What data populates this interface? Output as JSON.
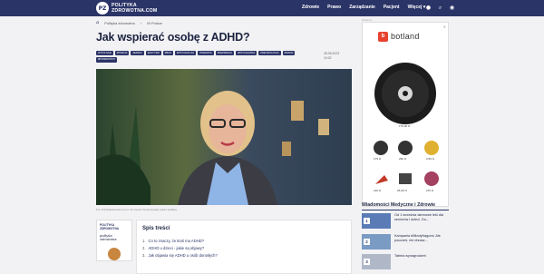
{
  "header": {
    "logo_badge": "PZ",
    "logo_line1": "POLITYKA",
    "logo_line2": "ZDROWOTNA.COM",
    "nav": [
      "Zdrowie",
      "Prawo",
      "Zarządzanie",
      "Pacjent",
      "Więcej"
    ],
    "nav_more_icon": "chevron-down-icon",
    "icons": [
      "user-icon",
      "search-icon",
      "account-icon"
    ],
    "colors": {
      "navy": "#2b3467"
    }
  },
  "breadcrumb": {
    "items": [
      "Polityka zdrowotna",
      "W Polsce"
    ]
  },
  "article": {
    "title": "Jak wspierać osobę z ADHD?",
    "tags": [
      "W POLSCE",
      "#PSMOA",
      "#EDIDU",
      "#AUTYZM",
      "#BAS",
      "#PSYCHOLOG",
      "#TERAPIA",
      "#DEPRESJA",
      "#PSYCHIATRA",
      "#NEUROLOGIA",
      "#MAMA",
      "#PODROSTNY"
    ],
    "date_line1": "28.06.2023",
    "date_line2": "10:02",
    "caption": "Fot. PoliTykaZdrowotna.com / Dr Joanna Tomaszewska, lekarz pediatra",
    "author_logo_line1": "POLITYKA",
    "author_logo_line2": "ZDROWOTNA",
    "author_name_line1": "polityka",
    "author_name_line2": "zdrowotna"
  },
  "toc": {
    "title": "Spis treści",
    "items": [
      {
        "num": "1.",
        "label": "Co to znaczy, że ktoś ma ADHD?"
      },
      {
        "num": "2.",
        "label": "ADHD u dzieci - jakie są objawy?"
      },
      {
        "num": "3.",
        "label": "Jak objawia się ADHD u osób dorosłych?"
      }
    ]
  },
  "ad": {
    "label": "Reklama",
    "brand": "botland",
    "close": "✕",
    "prices": [
      "179,00 zł",
      "179 zł",
      "290 zł",
      "3,50 zł",
      "120 zł",
      "25,00 zł",
      "270 zł"
    ]
  },
  "news": {
    "heading": "Wiadomości Medyczne i Zdrowie",
    "items": [
      {
        "num": "1",
        "text": "Od 1 września darmowe leki dla seniorów i dzieci. Do..."
      },
      {
        "num": "2",
        "text": "Kampania #MłodyNagomi. Ale poucześ, nie drzasz..."
      },
      {
        "num": "3",
        "text": "Tabela wynagrodzeń"
      }
    ]
  }
}
